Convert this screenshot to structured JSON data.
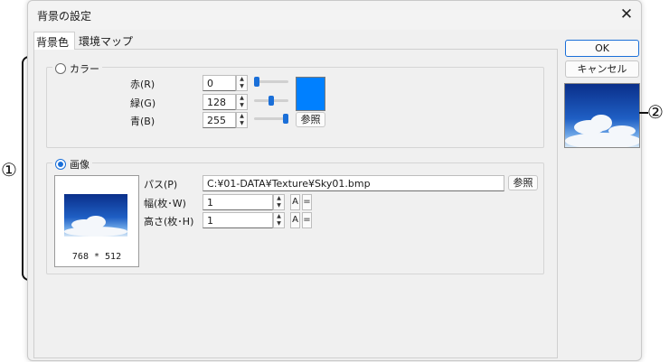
{
  "window": {
    "title": "背景の設定",
    "close_symbol": "✕"
  },
  "tabs": [
    {
      "label": "背景色"
    },
    {
      "label": "環境マップ"
    }
  ],
  "color_group": {
    "label": "カラー",
    "red": {
      "label": "赤(R)",
      "value": "0",
      "slider_fraction": 0.0
    },
    "green": {
      "label": "緑(G)",
      "value": "128",
      "slider_fraction": 0.5
    },
    "blue": {
      "label": "青(B)",
      "value": "255",
      "slider_fraction": 1.0
    },
    "swatch_color": "#0080ff",
    "browse_label": "参照"
  },
  "image_group": {
    "label": "画像",
    "path_label": "パス(P)",
    "path_value": "C:¥01-DATA¥Texture¥Sky01.bmp",
    "browse_label": "参照",
    "width_label": "幅(枚･W)",
    "width_value": "1",
    "height_label": "高さ(枚･H)",
    "height_value": "1",
    "a_label": "A",
    "eq_label": "=",
    "preview_size": "768 * 512"
  },
  "buttons": {
    "ok": "OK",
    "cancel": "キャンセル"
  },
  "annotations": {
    "one": "①",
    "two": "②"
  },
  "colors": {
    "accent": "#1a6fd8",
    "swatch": "#0080ff"
  }
}
